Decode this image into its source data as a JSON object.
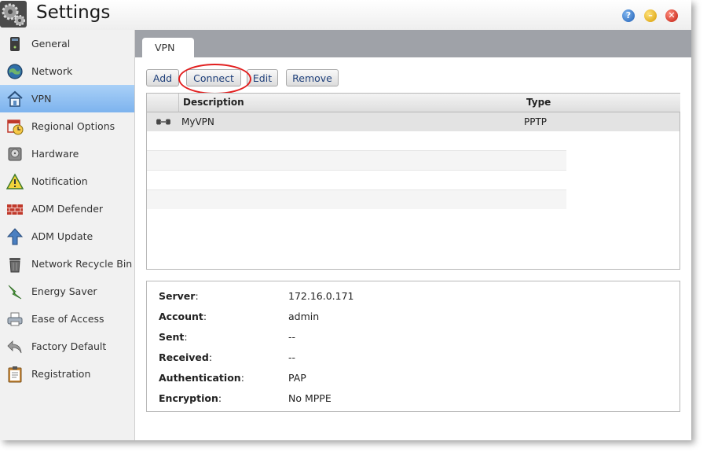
{
  "window": {
    "title": "Settings",
    "logo_icon": "gear-cogs-icon",
    "controls": [
      {
        "name": "help",
        "glyph": "?"
      },
      {
        "name": "minimize",
        "glyph": "–"
      },
      {
        "name": "close",
        "glyph": "✕"
      }
    ]
  },
  "sidebar": {
    "active_index": 2,
    "items": [
      {
        "label": "General",
        "icon": "server-icon"
      },
      {
        "label": "Network",
        "icon": "globe-icon"
      },
      {
        "label": "VPN",
        "icon": "vpn-house-icon"
      },
      {
        "label": "Regional Options",
        "icon": "calendar-clock-icon"
      },
      {
        "label": "Hardware",
        "icon": "hard-drive-icon"
      },
      {
        "label": "Notification",
        "icon": "warning-icon"
      },
      {
        "label": "ADM Defender",
        "icon": "firewall-icon"
      },
      {
        "label": "ADM Update",
        "icon": "upload-arrow-icon"
      },
      {
        "label": "Network Recycle Bin",
        "icon": "trash-icon"
      },
      {
        "label": "Energy Saver",
        "icon": "lightning-icon"
      },
      {
        "label": "Ease of Access",
        "icon": "printer-icon"
      },
      {
        "label": "Factory Default",
        "icon": "undo-arrow-icon"
      },
      {
        "label": "Registration",
        "icon": "clipboard-icon"
      }
    ]
  },
  "main": {
    "tab_label": "VPN",
    "toolbar": {
      "add_label": "Add",
      "connect_label": "Connect",
      "edit_label": "Edit",
      "remove_label": "Remove"
    },
    "table": {
      "columns": [
        "Description",
        "Type"
      ],
      "rows": [
        {
          "description": "MyVPN",
          "type": "PPTP"
        }
      ]
    },
    "details": [
      {
        "label": "Server",
        "value": "172.16.0.171"
      },
      {
        "label": "Account",
        "value": "admin"
      },
      {
        "label": "Sent",
        "value": "--"
      },
      {
        "label": "Received",
        "value": "--"
      },
      {
        "label": "Authentication",
        "value": "PAP"
      },
      {
        "label": "Encryption",
        "value": "No MPPE"
      }
    ]
  },
  "colors": {
    "active_item": "#7db3ee",
    "tab_bar": "#9fa2a8",
    "highlight_circle": "#e21e1e",
    "button_text": "#1e3f7a"
  }
}
